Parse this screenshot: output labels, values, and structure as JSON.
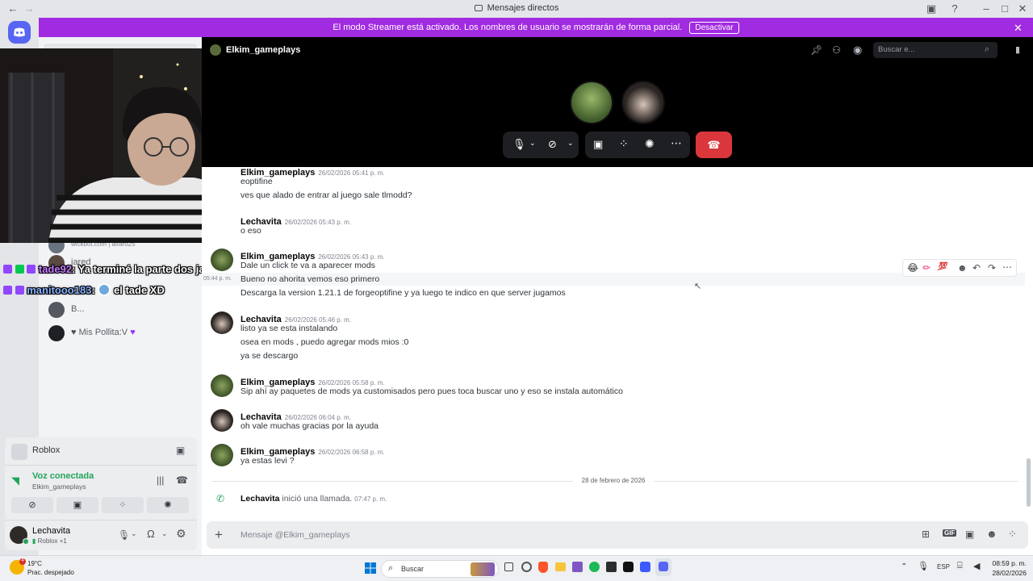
{
  "window": {
    "title": "Mensajes directos"
  },
  "banner": {
    "message": "El modo Streamer está activado. Los nombres de usuario se mostrarán de forma parcial.",
    "deactivate_label": "Desactivar"
  },
  "header": {
    "channel_name": "Elkim_gameplays",
    "search_placeholder": "Buscar e..."
  },
  "sidebar": {
    "items": [
      {
        "name": "wickbot.com | alfaro25"
      },
      {
        "name": "jared"
      },
      {
        "name": "B..."
      },
      {
        "name": "Mis Pollita:V"
      }
    ]
  },
  "stream_chat": [
    {
      "user": "tade92",
      "text": ": Ya terminé la parte dos jajaja",
      "color": "#c77dff"
    },
    {
      "user": "manitooo183",
      "text": "el tade XD",
      "color": "#8ab4ff"
    }
  ],
  "messages": [
    {
      "author": "Elkim_gameplays",
      "ts": "26/02/2026 05:41 p. m.",
      "lines": [
        "eoptifine",
        "ves que alado de entrar al juego sale tlmodd?"
      ]
    },
    {
      "author": "Lechavita",
      "ts": "26/02/2026 05:43 p. m.",
      "lines": [
        "o eso"
      ]
    },
    {
      "author": "Elkim_gameplays",
      "ts": "26/02/2026 05:43 p. m.",
      "lines": [
        "Dale un click te va a aparecer mods",
        "Bueno no ahorita vemos eso primero",
        "Descarga la version 1.21.1 de forgeoptifine y ya luego te indico en que server jugamos"
      ],
      "hover_ts": "05:44 p. m."
    },
    {
      "author": "Lechavita",
      "ts": "26/02/2026 05:46 p. m.",
      "lines": [
        "listo ya se esta instalando",
        "osea en mods , puedo agregar mods mios :0",
        "ya se descargo"
      ]
    },
    {
      "author": "Elkim_gameplays",
      "ts": "26/02/2026 05:58 p. m.",
      "lines": [
        "Sip ahí ay paquetes de mods ya customisados pero pues toca buscar uno y eso se instala automático"
      ]
    },
    {
      "author": "Lechavita",
      "ts": "26/02/2026 06:04 p. m.",
      "lines": [
        "oh vale muchas gracias por la ayuda"
      ]
    },
    {
      "author": "Elkim_gameplays",
      "ts": "26/02/2026 06:58 p. m.",
      "lines": [
        "ya estas levi ?"
      ]
    }
  ],
  "date_divider": "28 de febrero de 2026",
  "call_event": {
    "author": "Lechavita",
    "text": "inició una llamada.",
    "ts": "07:47 p. m."
  },
  "composer": {
    "placeholder": "Mensaje @Elkim_gameplays"
  },
  "activity": {
    "game": "Roblox"
  },
  "voice": {
    "status": "Voz conectada",
    "channel": "Elkim_gameplays"
  },
  "user": {
    "name": "Lechavita",
    "activity": "Roblox +1"
  },
  "taskbar": {
    "temp": "19°C",
    "weather": "Prac. despejado",
    "search": "Buscar",
    "lang": "ESP",
    "time": "08:59 p. m.",
    "date": "28/02/2026"
  },
  "colors": {
    "accent": "#5865f2",
    "streamer": "#a12be0",
    "hangup": "#da373c",
    "online": "#23a55a"
  }
}
